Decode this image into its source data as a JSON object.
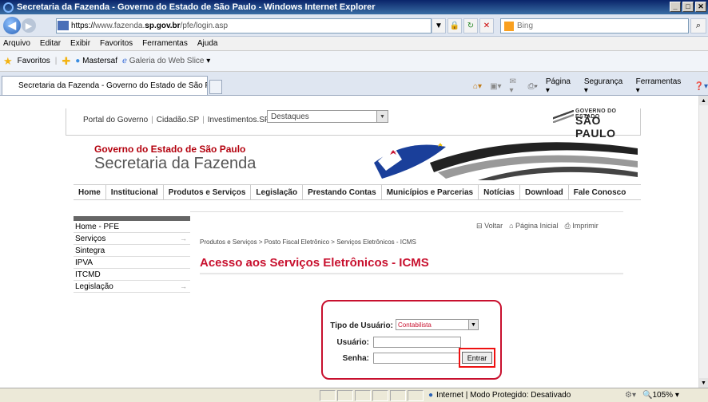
{
  "window": {
    "title": "Secretaria da Fazenda - Governo do Estado de São Paulo - Windows Internet Explorer"
  },
  "address": {
    "protocol": "https://",
    "domain_prefix": "www.fazenda.",
    "domain_bold": "sp.gov.br",
    "path": "/pfe/login.asp"
  },
  "search": {
    "placeholder": "Bing"
  },
  "menu": [
    "Arquivo",
    "Editar",
    "Exibir",
    "Favoritos",
    "Ferramentas",
    "Ajuda"
  ],
  "favorites": {
    "label": "Favoritos",
    "items": [
      "Mastersaf",
      "Galeria do Web Slice"
    ]
  },
  "tab": {
    "title": "Secretaria da Fazenda - Governo do Estado de São P..."
  },
  "commandbar": [
    "Página",
    "Segurança",
    "Ferramentas"
  ],
  "portal": {
    "links": [
      "Portal do Governo",
      "Cidadão.SP",
      "Investimentos.SP"
    ],
    "select": "Destaques",
    "logo_line1": "GOVERNO DO ESTADO",
    "logo_line2": "SÃO PAULO"
  },
  "header": {
    "line1": "Governo do Estado de São Paulo",
    "line2": "Secretaria da Fazenda"
  },
  "nav": [
    "Home",
    "Institucional",
    "Produtos e Serviços",
    "Legislação",
    "Prestando Contas",
    "Municípios e Parcerias",
    "Notícias",
    "Download",
    "Fale Conosco"
  ],
  "sidemenu": [
    {
      "label": "Home - PFE",
      "arrow": ""
    },
    {
      "label": "Serviços",
      "arrow": "→"
    },
    {
      "label": "Sintegra",
      "arrow": ""
    },
    {
      "label": "IPVA",
      "arrow": ""
    },
    {
      "label": "ITCMD",
      "arrow": ""
    },
    {
      "label": "Legislação",
      "arrow": "→"
    }
  ],
  "actions": {
    "voltar": "Voltar",
    "inicial": "Página Inicial",
    "imprimir": "Imprimir"
  },
  "breadcrumb": "Produtos e Serviços > Posto Fiscal Eletrônico > Serviços Eletrônicos - ICMS",
  "page_title": "Acesso aos Serviços Eletrônicos - ICMS",
  "login": {
    "type_label": "Tipo de Usuário:",
    "type_value": "Contabilista",
    "user_label": "Usuário:",
    "pass_label": "Senha:",
    "submit": "Entrar"
  },
  "status": {
    "zone": "Internet | Modo Protegido: Desativado",
    "zoom": "105%"
  }
}
